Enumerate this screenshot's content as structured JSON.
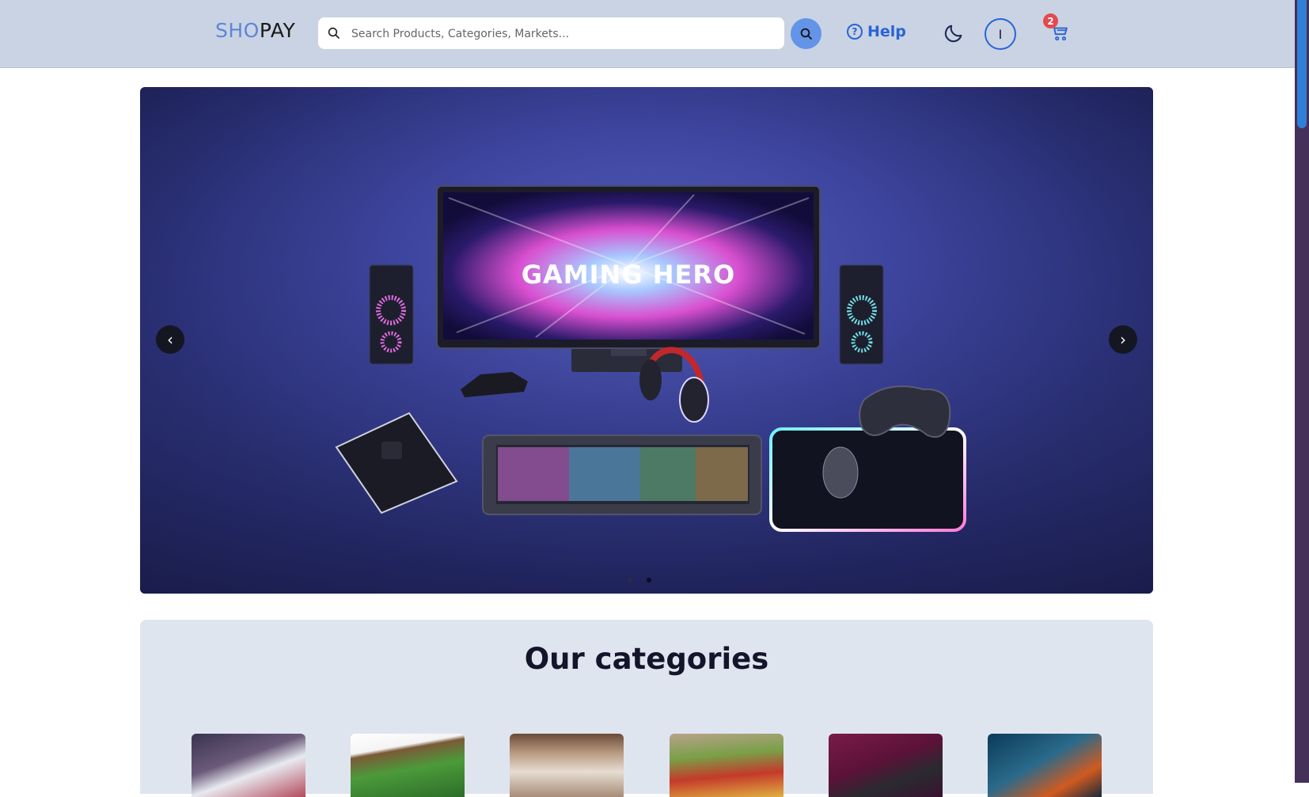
{
  "header": {
    "logo_part1": "SHO",
    "logo_part2": "PAY",
    "search_placeholder": "Search Products, Categories, Markets...",
    "help_label": "Help",
    "avatar_initial": "I",
    "cart_count": "2"
  },
  "carousel": {
    "slide_text": "GAMING HERO",
    "prev_label": "‹",
    "next_label": "›",
    "slides_total": 2,
    "active_slide": 2
  },
  "categories": {
    "title": "Our categories"
  },
  "colors": {
    "header_bg": "#c9d3e3",
    "accent": "#2a63d6",
    "badge": "#e5484d",
    "categories_bg": "#dfe5ef"
  },
  "icons": [
    "search-icon",
    "help-icon",
    "moon-icon",
    "cart-icon",
    "chevron-left-icon",
    "chevron-right-icon"
  ]
}
